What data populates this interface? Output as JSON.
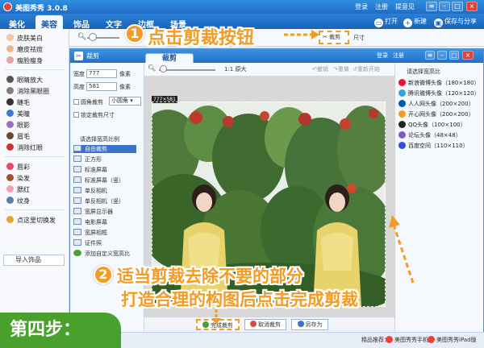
{
  "app": {
    "title": "美图秀秀 3.0.8",
    "header_links": [
      "登录",
      "注册",
      "提意见"
    ],
    "menu_tabs": [
      "美化",
      "美容",
      "饰品",
      "文字",
      "边框",
      "场景"
    ],
    "toolbar_right": [
      "打开",
      "新建",
      "保存与分享"
    ]
  },
  "main_toolbar": {
    "crop_button": "裁剪",
    "size_label": "尺寸"
  },
  "left_panel": {
    "items": [
      "皮肤美白",
      "磨皮祛痘",
      "瘦脸瘦身",
      "眼睛放大",
      "消除黑眼圈",
      "睫毛",
      "美瞳",
      "眼影",
      "眉毛",
      "消除红眼",
      "唇彩",
      "染发",
      "腮红",
      "纹身",
      "点这里切换发"
    ],
    "import_button": "导入饰品"
  },
  "dialog": {
    "title": "裁剪",
    "tab": "裁剪",
    "header_links": [
      "登录",
      "注册"
    ],
    "width_label": "宽度",
    "width_value": "777",
    "height_label": "高度",
    "height_value": "581",
    "unit": "像素",
    "round_crop": "圆角裁剪",
    "round_select": "小圆角",
    "lock_size": "锁定裁剪尺寸",
    "ratio_header": "请选择宽高比例",
    "ratio_options": [
      "自由裁剪",
      "正方形",
      "标准屏幕",
      "标准屏幕（竖）",
      "单反相机",
      "单反相机（竖）",
      "宽屏显示器",
      "电影屏幕",
      "宽屏相框",
      "证件照",
      "添加自定义宽高比"
    ],
    "zoom_ratio": "1:1",
    "zoom_label": "原大",
    "actions": [
      "撤销",
      "重做",
      "重新开始"
    ],
    "dimension_badge": "777×581",
    "right_header": "请选择宽高比",
    "right_items": [
      "新浪微博头像（180×180）",
      "腾讯微博头像（120×120）",
      "人人网头像（200×200）",
      "开心网头像（200×200）",
      "QQ头像（100×100）",
      "论坛头像（48×48）",
      "百度空间（110×110）"
    ],
    "buttons": {
      "complete": "完成裁剪",
      "cancel": "取消裁剪",
      "save_as": "另存为"
    }
  },
  "status_bar": [
    "精品推荐：",
    "美图秀秀手机版",
    "美图秀秀iPad版"
  ],
  "overlay": {
    "step1_num": "1",
    "step1_text": "点击剪裁按钮",
    "step2_num": "2",
    "step2_line1": "适当剪裁去除不要的部分",
    "step2_line2": "打造合理的构图后点击完成剪裁",
    "step_label": "第四步："
  },
  "colors": {
    "accent": "#f39b22",
    "title_blue": "#2170c8",
    "step_green": "#4aa02c"
  }
}
